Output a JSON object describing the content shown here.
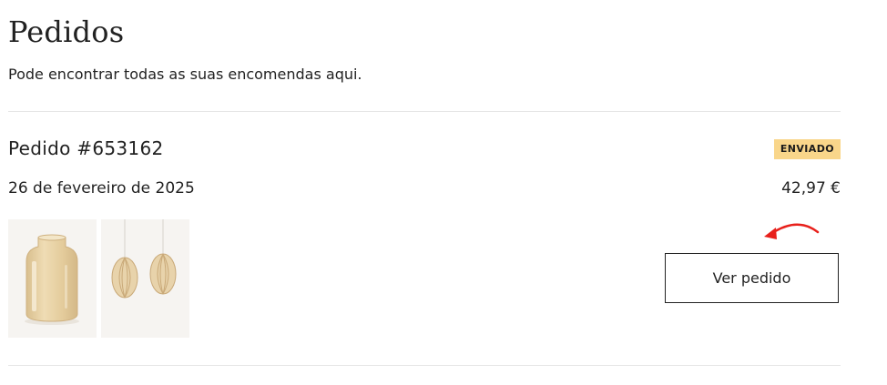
{
  "page": {
    "title": "Pedidos",
    "subtitle": "Pode encontrar todas as suas encomendas aqui."
  },
  "order": {
    "number": "Pedido #653162",
    "status": "ENVIADO",
    "status_color": "#f9d68a",
    "date": "26 de fevereiro de 2025",
    "total": "42,97 €",
    "view_button_label": "Ver pedido",
    "products": [
      {
        "name": "glass-vase-image"
      },
      {
        "name": "wooden-ornaments-image"
      }
    ]
  },
  "annotation": {
    "arrow_color": "#e8201b"
  }
}
